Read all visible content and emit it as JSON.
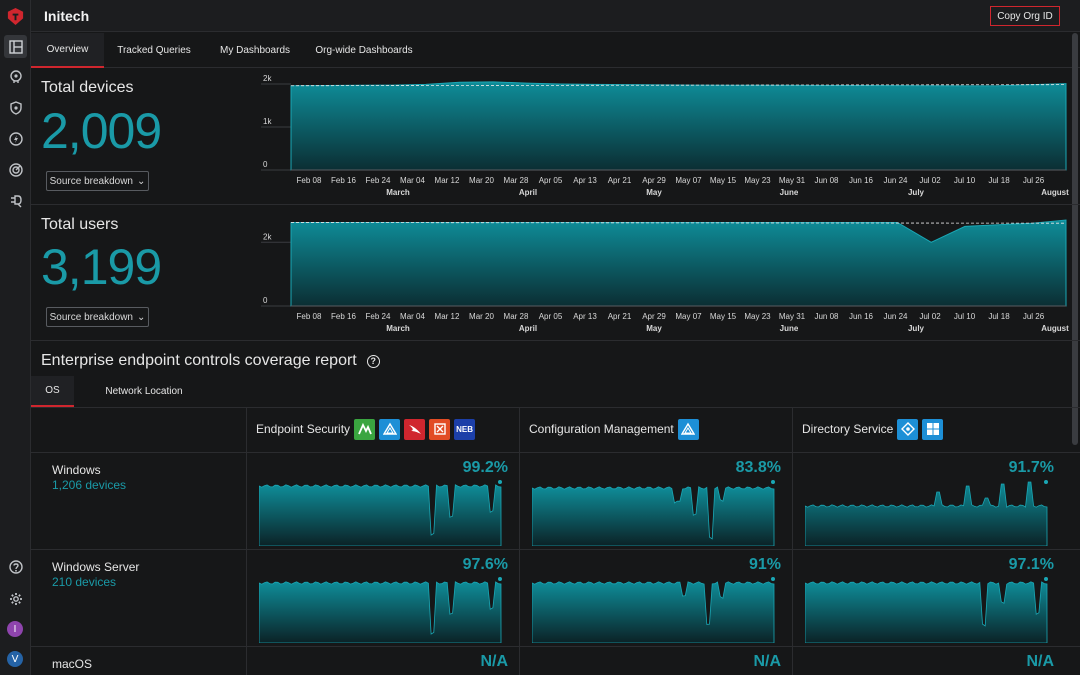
{
  "app": {
    "title": "Initech",
    "copy_org_label": "Copy Org ID"
  },
  "nav_tabs": [
    {
      "label": "Overview",
      "active": true
    },
    {
      "label": "Tracked Queries",
      "active": false
    },
    {
      "label": "My Dashboards",
      "active": false
    },
    {
      "label": "Org-wide Dashboards",
      "active": false
    }
  ],
  "sidebar": {
    "icons": [
      "dashboard-icon",
      "brain-icon",
      "shield-icon",
      "bolt-icon",
      "radar-icon",
      "plug-icon"
    ],
    "bottom_icons": [
      "help-icon",
      "gear-icon"
    ],
    "avatars": [
      {
        "letter": "I",
        "color": "#8e44ad"
      },
      {
        "letter": "V",
        "color": "#2563a6"
      }
    ]
  },
  "metrics": [
    {
      "title": "Total devices",
      "value": "2,009",
      "button": "Source breakdown"
    },
    {
      "title": "Total users",
      "value": "3,199",
      "button": "Source breakdown"
    }
  ],
  "chart_data": [
    {
      "type": "area",
      "title": "Total devices",
      "y_ticks": [
        "0",
        "1k",
        "2k"
      ],
      "ylim": [
        0,
        2000
      ],
      "x_ticks": [
        "Feb 08",
        "Feb 16",
        "Feb 24",
        "Mar 04",
        "Mar 12",
        "Mar 20",
        "Mar 28",
        "Apr 05",
        "Apr 13",
        "Apr 21",
        "Apr 29",
        "May 07",
        "May 15",
        "May 23",
        "May 31",
        "Jun 08",
        "Jun 16",
        "Jun 24",
        "Jul 02",
        "Jul 10",
        "Jul 18",
        "Jul 26"
      ],
      "months": [
        "March",
        "April",
        "May",
        "June",
        "July",
        "August"
      ],
      "values": [
        1960,
        1965,
        1970,
        1975,
        1990,
        2040,
        2050,
        2020,
        2000,
        1990,
        1985,
        1980,
        1975,
        1970,
        1970,
        1968,
        1965,
        1965,
        1962,
        1960,
        1955,
        1960,
        1985,
        2009
      ]
    },
    {
      "type": "area",
      "title": "Total users",
      "y_ticks": [
        "0",
        "2k"
      ],
      "ylim": [
        0,
        2700
      ],
      "x_ticks": [
        "Feb 08",
        "Feb 16",
        "Feb 24",
        "Mar 04",
        "Mar 12",
        "Mar 20",
        "Mar 28",
        "Apr 05",
        "Apr 13",
        "Apr 21",
        "Apr 29",
        "May 07",
        "May 15",
        "May 23",
        "May 31",
        "Jun 08",
        "Jun 16",
        "Jun 24",
        "Jul 02",
        "Jul 10",
        "Jul 18",
        "Jul 26"
      ],
      "months": [
        "March",
        "April",
        "May",
        "June",
        "July",
        "August"
      ],
      "values": [
        2620,
        2620,
        2620,
        2620,
        2620,
        2620,
        2620,
        2620,
        2620,
        2620,
        2620,
        2620,
        2620,
        2620,
        2620,
        2620,
        2620,
        2620,
        2620,
        2000,
        2500,
        2550,
        2600,
        2700
      ]
    }
  ],
  "coverage": {
    "title": "Enterprise endpoint controls coverage report",
    "subtabs": [
      {
        "label": "OS",
        "active": true
      },
      {
        "label": "Network Location",
        "active": false
      }
    ],
    "columns": [
      {
        "label": "Endpoint Security",
        "badges": [
          {
            "icon": "mountain-icon",
            "color": "#3aa540",
            "text": ""
          },
          {
            "icon": "triangle-icon",
            "color": "#1d8fd6",
            "text": ""
          },
          {
            "icon": "falcon-icon",
            "color": "#d0262e",
            "text": ""
          },
          {
            "icon": "target-icon",
            "color": "#e24c24",
            "text": ""
          },
          {
            "icon": "malwarebytes-icon",
            "color": "#1c3fa8",
            "text": "NEB"
          }
        ]
      },
      {
        "label": "Configuration Management",
        "badges": [
          {
            "icon": "triangle-icon",
            "color": "#1d8fd6",
            "text": ""
          }
        ]
      },
      {
        "label": "Directory Service",
        "badges": [
          {
            "icon": "azure-ad-icon",
            "color": "#1d8fd6",
            "text": ""
          },
          {
            "icon": "windows-icon",
            "color": "#1d8fd6",
            "text": ""
          }
        ]
      }
    ],
    "rows": [
      {
        "os": "Windows",
        "count": "1,206 devices",
        "cells": [
          "99.2%",
          "83.8%",
          "91.7%"
        ]
      },
      {
        "os": "Windows Server",
        "count": "210 devices",
        "cells": [
          "97.6%",
          "91%",
          "97.1%"
        ]
      },
      {
        "os": "macOS",
        "count": "",
        "cells": [
          "N/A",
          "N/A",
          "N/A"
        ]
      }
    ]
  }
}
